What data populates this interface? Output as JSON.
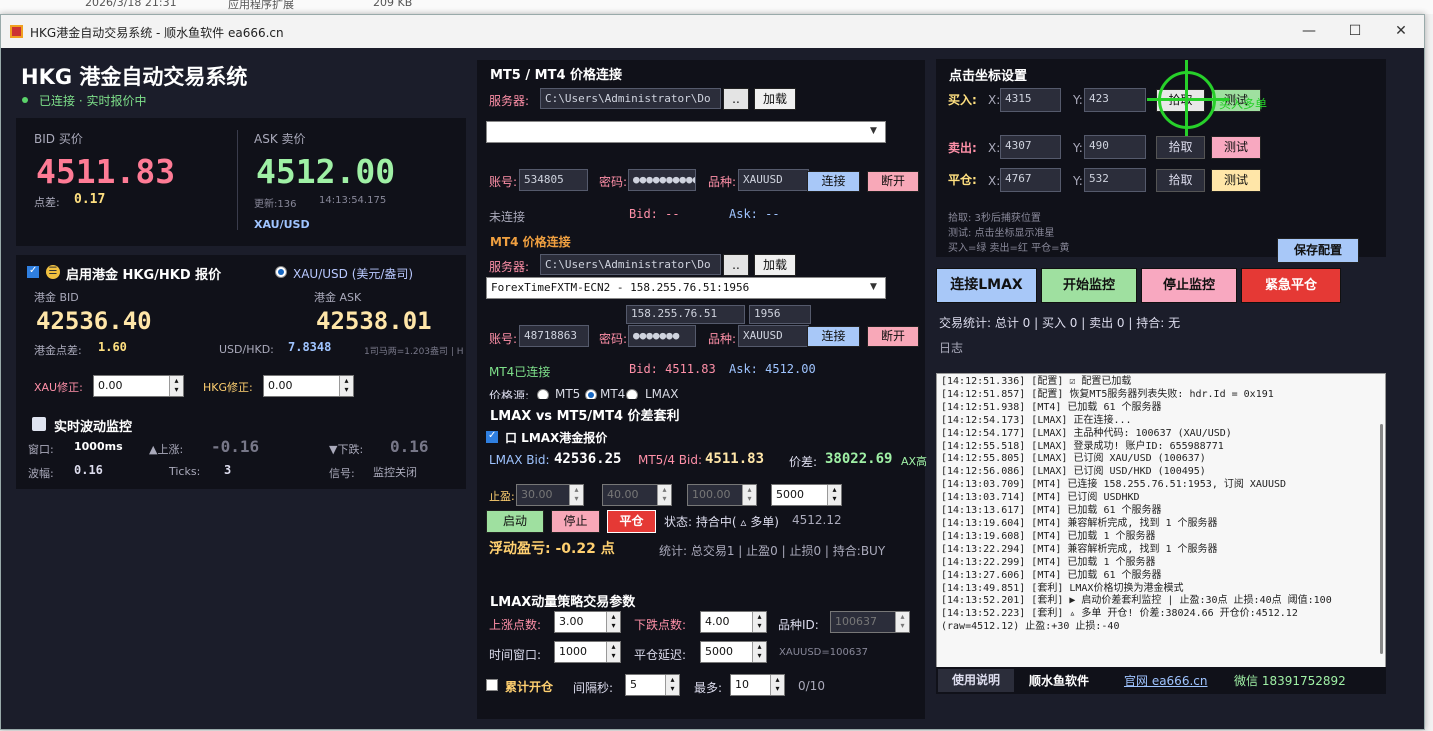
{
  "bgstrip": {
    "date": "2026/3/18 21:31",
    "type": "应用程序扩展",
    "size": "209 KB"
  },
  "window": {
    "title": "HKG港金自动交易系统 - 顺水鱼软件 ea666.cn",
    "min": "—",
    "max": "☐",
    "close": "✕"
  },
  "header": {
    "title": "HKG 港金自动交易系统",
    "status": "已连接 · 实时报价中"
  },
  "quote": {
    "bid_label": "BID 买价",
    "bid": "4511.83",
    "spread_label": "点差:",
    "spread": "0.17",
    "ask_label": "ASK 卖价",
    "ask": "4512.00",
    "update": "更新:136",
    "time": "14:13:54.175",
    "symbol": "XAU/USD"
  },
  "hkg": {
    "enable_label": "启用港金 HKG/HKD 报价",
    "radio_label": "XAU/USD (美元/盎司)",
    "bid_label": "港金 BID",
    "bid": "42536.40",
    "ask_label": "港金 ASK",
    "ask": "42538.01",
    "spread_label": "港金点差:",
    "spread": "1.60",
    "rate_label": "USD/HKD:",
    "rate": "7.8348",
    "note": "1司马两=1.203盎司 | H",
    "xau_adj_label": "XAU修正:",
    "xau_adj": "0.00",
    "hkg_adj_label": "HKG修正:",
    "hkg_adj": "0.00"
  },
  "monitor": {
    "title": "实时波动监控",
    "window_label": "窗口:",
    "window": "1000ms",
    "up_label": "▲上涨:",
    "up": "-0.16",
    "down_label": "▼下跌:",
    "down": "0.16",
    "amp_label": "波幅:",
    "amp": "0.16",
    "ticks_label": "Ticks:",
    "ticks": "3",
    "signal_label": "信号:",
    "signal": "监控关闭"
  },
  "mt5": {
    "title": "MT5 / MT4 价格连接",
    "server_label": "服务器:",
    "server_path": "C:\\Users\\Administrator\\Do",
    "browse": "..",
    "load": "加载",
    "account_label": "账号:",
    "account": "534805",
    "password_label": "密码:",
    "password": "●●●●●●●●●●●",
    "symbol_label": "品种:",
    "symbol": "XAUUSD",
    "connect": "连接",
    "disconnect": "断开",
    "status": "未连接",
    "bid": "Bid: --",
    "ask": "Ask: --"
  },
  "mt4": {
    "title": "MT4 价格连接",
    "server_label": "服务器:",
    "server_path": "C:\\Users\\Administrator\\Do",
    "browse": "..",
    "load": "加载",
    "server_select": "ForexTimeFXTM-ECN2 - 158.255.76.51:1956",
    "ip": "158.255.76.51",
    "port": "1956",
    "account_label": "账号:",
    "account": "48718863",
    "password_label": "密码:",
    "password": "●●●●●●●",
    "symbol_label": "品种:",
    "symbol": "XAUUSD",
    "connect": "连接",
    "disconnect": "断开",
    "status": "MT4已连接",
    "bid": "Bid: 4511.83",
    "ask": "Ask: 4512.00",
    "source_label": "价格源:",
    "sources": [
      "MT5",
      "MT4",
      "LMAX"
    ]
  },
  "arb": {
    "title": "LMAX vs MT5/MT4 价差套利",
    "enable_label": "口 LMAX港金报价",
    "lmax_bid_label": "LMAX Bid:",
    "lmax_bid": "42536.25",
    "mt_bid_label": "MT5/4 Bid:",
    "mt_bid": "4511.83",
    "diff_label": "价差:",
    "diff": "38022.69",
    "ax_label": "AX高",
    "tp_label": "止盈:",
    "tp": "30.00",
    "sl": "40.00",
    "th": "100.00",
    "qty": "5000",
    "start": "启动",
    "stop": "停止",
    "close": "平仓",
    "state": "状态: 持合中( ▵ 多单)",
    "state_price": "4512.12",
    "pnl": "浮动盈亏: -0.22 点",
    "stats": "统计: 总交易1 | 止盈0 | 止损0 | 持合:BUY"
  },
  "strategy": {
    "title": "LMAX动量策略交易参数",
    "up_label": "上涨点数:",
    "up": "3.00",
    "down_label": "下跌点数:",
    "down": "4.00",
    "symid_label": "品种ID:",
    "symid": "100637",
    "window_label": "时间窗口:",
    "window": "1000",
    "delay_label": "平仓延迟:",
    "delay": "5000",
    "symid_note": "XAUUSD=100637",
    "accum_label": "累计开仓",
    "interval_label": "间隔秒:",
    "interval": "5",
    "max_label": "最多:",
    "max": "10",
    "count": "0/10"
  },
  "coords": {
    "title": "点击坐标设置",
    "buy_label": "买入:",
    "sell_label": "卖出:",
    "close_label": "平仓:",
    "x_label": "X:",
    "y_label": "Y:",
    "buy_x": "4315",
    "buy_y": "423",
    "sell_x": "4307",
    "sell_y": "490",
    "close_x": "4767",
    "close_y": "532",
    "pick": "拾取",
    "test": "测试",
    "buy_overlay": "买入多单",
    "help1": "拾取: 3秒后捕获位置",
    "help2": "测试: 点击坐标显示准星",
    "help3": "买入=绿 卖出=红 平仓=黄",
    "save": "保存配置"
  },
  "actions": {
    "connect_lmax": "连接LMAX",
    "start_monitor": "开始监控",
    "stop_monitor": "停止监控",
    "emergency": "紧急平仓"
  },
  "stats": {
    "text": "交易统计: 总计 0 | 买入 0 | 卖出 0 | 持合: 无"
  },
  "log": {
    "title": "日志",
    "lines": [
      "[14:12:51.336] [配置] ☑ 配置已加载",
      "[14:12:51.857] [配置] 恢复MT5服务器列表失败: hdr.Id = 0x191",
      "[14:12:51.938] [MT4] 已加载 61 个服务器",
      "[14:12:54.173] [LMAX] 正在连接...",
      "[14:12:54.177] [LMAX] 主品种代码: 100637 (XAU/USD)",
      "[14:12:55.518] [LMAX] 登录成功! 账户ID: 655988771",
      "[14:12:55.805] [LMAX] 已订阅 XAU/USD (100637)",
      "[14:12:56.086] [LMAX] 已订阅 USD/HKD (100495)",
      "[14:13:03.709] [MT4] 已连接 158.255.76.51:1953, 订阅 XAUUSD",
      "[14:13:03.714] [MT4] 已订阅 USDHKD",
      "[14:13:13.617] [MT4] 已加载 61 个服务器",
      "[14:13:19.604] [MT4] 兼容解析完成, 找到 1 个服务器",
      "[14:13:19.608] [MT4] 已加载 1 个服务器",
      "[14:13:22.294] [MT4] 兼容解析完成, 找到 1 个服务器",
      "[14:13:22.299] [MT4] 已加载 1 个服务器",
      "[14:13:27.606] [MT4] 已加载 61 个服务器",
      "[14:13:49.851] [套利] LMAX价格切换为港金模式",
      "[14:13:52.201] [套利] ▶ 启动价差套利监控 | 止盈:30点 止损:40点 阈值:100",
      "[14:13:52.223] [套利] ▵ 多单 开仓! 价差:38024.66 开仓价:4512.12 (raw=4512.12) 止盈:+30 止损:-40"
    ]
  },
  "footer": {
    "help": "使用说明",
    "brand": "顺水鱼软件",
    "site": "官网 ea666.cn",
    "wechat": "微信 18391752892"
  }
}
